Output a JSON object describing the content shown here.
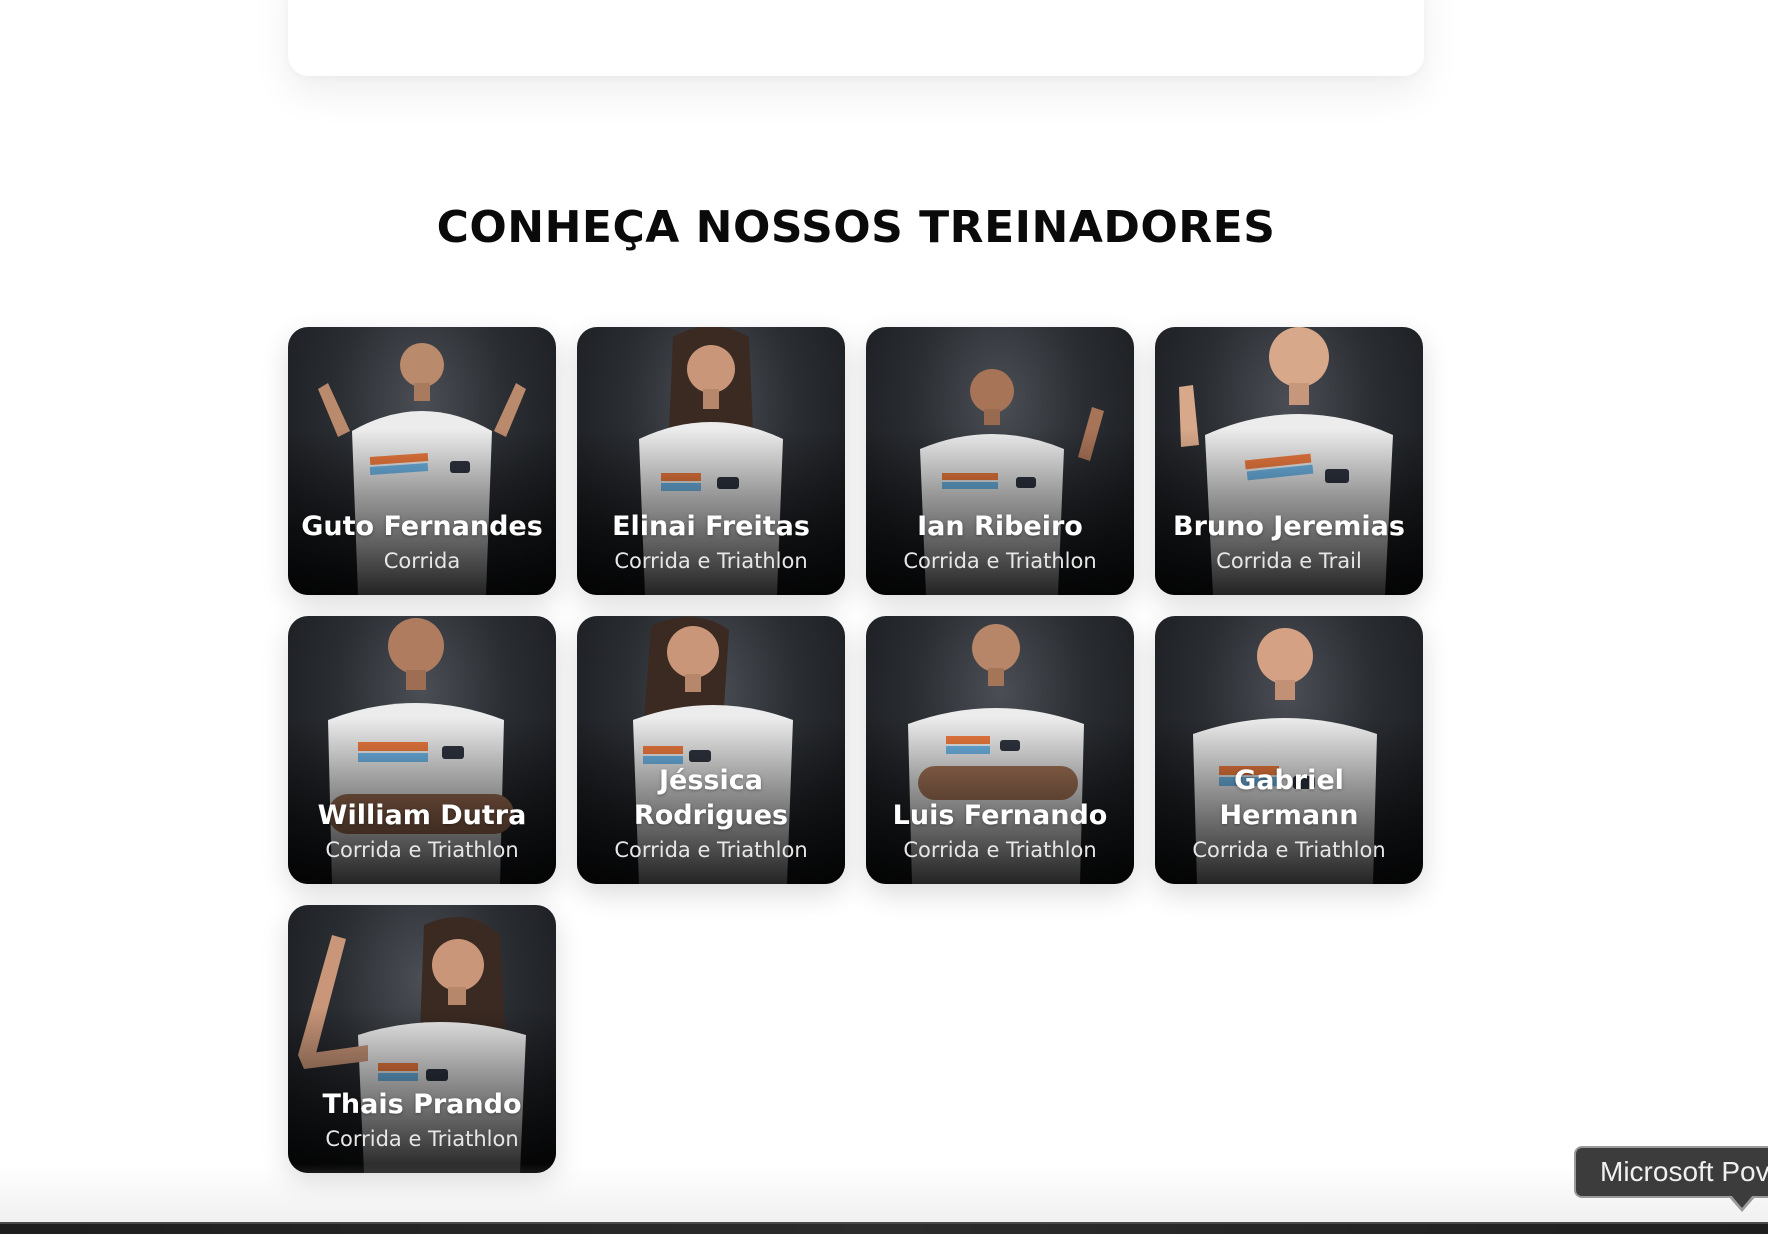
{
  "section": {
    "title": "CONHEÇA NOSSOS TREINADORES"
  },
  "coaches": [
    {
      "name": "Guto Fernandes",
      "sport": "Corrida"
    },
    {
      "name": "Elinai Freitas",
      "sport": "Corrida e Triathlon"
    },
    {
      "name": "Ian Ribeiro",
      "sport": "Corrida e Triathlon"
    },
    {
      "name": "Bruno Jeremias",
      "sport": "Corrida e Trail"
    },
    {
      "name": "William Dutra",
      "sport": "Corrida e Triathlon"
    },
    {
      "name": "Jéssica Rodrigues",
      "sport": "Corrida e Triathlon"
    },
    {
      "name": "Luis Fernando",
      "sport": "Corrida e Triathlon"
    },
    {
      "name": "Gabriel Hermann",
      "sport": "Corrida e Triathlon"
    },
    {
      "name": "Thais Prando",
      "sport": "Corrida e Triathlon"
    }
  ],
  "tooltip": {
    "text": "Microsoft Pov"
  },
  "colors": {
    "title": "#0a0a0a",
    "card_background": "#2a2d32",
    "shirt": "#ececec",
    "stripe_orange": "#ee7b3f",
    "stripe_blue": "#6fb6e8",
    "logo": "#2e3440",
    "tooltip_background": "#3c3c3c"
  },
  "icons": {
    "coach_photo": "coach-portrait-photo",
    "shirt_logo": "brand-logo-icon"
  }
}
